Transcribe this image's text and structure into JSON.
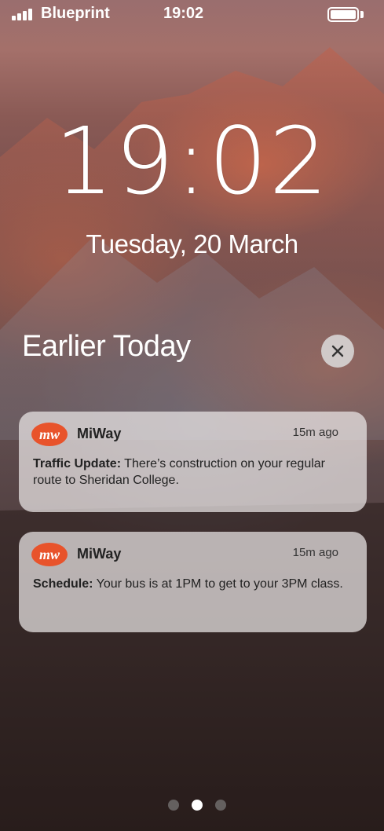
{
  "status_bar": {
    "carrier": "Blueprint",
    "time": "19:02"
  },
  "lock_screen": {
    "time": "19:02",
    "date": "Tuesday, 20 March"
  },
  "notification_center": {
    "section_title": "Earlier Today",
    "clear_icon": "close-icon"
  },
  "notifications": [
    {
      "app": "MiWay",
      "icon": "miway-logo-icon",
      "time": "15m ago",
      "title": "Traffic Update:",
      "message": " There’s construction on your regular route to Sheridan College."
    },
    {
      "app": "MiWay",
      "icon": "miway-logo-icon",
      "time": "15m ago",
      "title": "Schedule:",
      "message": " Your bus is at 1PM to get to your 3PM class."
    }
  ],
  "page_indicator": {
    "pages": 3,
    "active": 2
  },
  "colors": {
    "miway_brand": "#e8532b",
    "notification_bg": "#ebe8e8"
  }
}
